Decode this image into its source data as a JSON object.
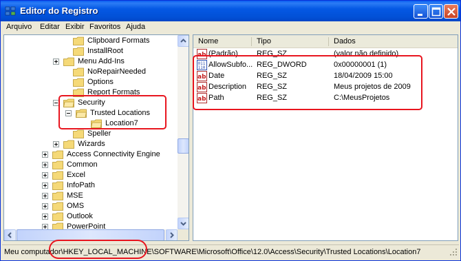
{
  "window": {
    "title": "Editor do Registro"
  },
  "menu": [
    "Arquivo",
    "Editar",
    "Exibir",
    "Favoritos",
    "Ajuda"
  ],
  "tree": [
    {
      "label": "Clipboard Formats",
      "expander": "none",
      "open": false
    },
    {
      "label": "InstallRoot",
      "expander": "none",
      "open": false
    },
    {
      "label": "Menu Add-Ins",
      "expander": "plus",
      "open": false
    },
    {
      "label": "NoRepairNeeded",
      "expander": "none",
      "open": false
    },
    {
      "label": "Options",
      "expander": "none",
      "open": false
    },
    {
      "label": "Report Formats",
      "expander": "none",
      "open": false
    },
    {
      "label": "Security",
      "expander": "minus",
      "open": true
    },
    {
      "label": "Trusted Locations",
      "expander": "minus",
      "open": true
    },
    {
      "label": "Location7",
      "expander": "none",
      "open": true
    },
    {
      "label": "Speller",
      "expander": "none",
      "open": false
    },
    {
      "label": "Wizards",
      "expander": "plus",
      "open": false
    },
    {
      "label": "Access Connectivity Engine",
      "expander": "plus",
      "open": false
    },
    {
      "label": "Common",
      "expander": "plus",
      "open": false
    },
    {
      "label": "Excel",
      "expander": "plus",
      "open": false
    },
    {
      "label": "InfoPath",
      "expander": "plus",
      "open": false
    },
    {
      "label": "MSE",
      "expander": "plus",
      "open": false
    },
    {
      "label": "OMS",
      "expander": "plus",
      "open": false
    },
    {
      "label": "Outlook",
      "expander": "plus",
      "open": false
    },
    {
      "label": "PowerPoint",
      "expander": "plus",
      "open": false
    }
  ],
  "list": {
    "headers": {
      "name": "Nome",
      "type": "Tipo",
      "data": "Dados"
    },
    "rows": [
      {
        "name": "(Padrão)",
        "type": "REG_SZ",
        "data": "(valor não definido)",
        "icon": "string-value-icon"
      },
      {
        "name": "AllowSubfo...",
        "type": "REG_DWORD",
        "data": "0x00000001 (1)",
        "icon": "binary-value-icon"
      },
      {
        "name": "Date",
        "type": "REG_SZ",
        "data": "18/04/2009 15:00",
        "icon": "string-value-icon"
      },
      {
        "name": "Description",
        "type": "REG_SZ",
        "data": "Meus projetos de 2009",
        "icon": "string-value-icon"
      },
      {
        "name": "Path",
        "type": "REG_SZ",
        "data": "C:\\MeusProjetos",
        "icon": "string-value-icon"
      }
    ]
  },
  "status": {
    "path": "Meu computador\\HKEY_LOCAL_MACHINE\\SOFTWARE\\Microsoft\\Office\\12.0\\Access\\Security\\Trusted Locations\\Location7"
  },
  "colors": {
    "titlebar": "#0458e4",
    "highlight": "#e8141e",
    "folder": "#f5d978"
  }
}
